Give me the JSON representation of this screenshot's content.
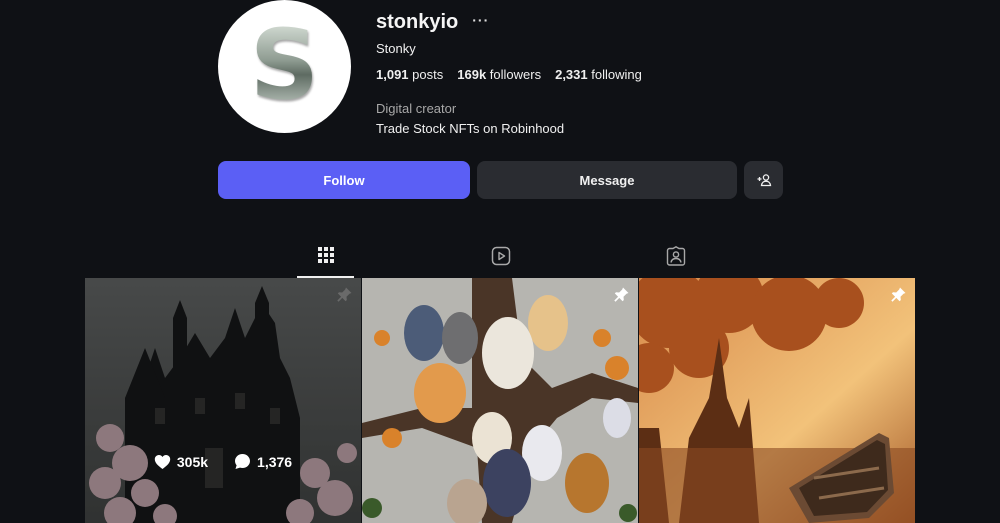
{
  "profile": {
    "avatar_letter": "S",
    "username": "stonkyio",
    "more_label": "···",
    "full_name": "Stonky",
    "stats": {
      "posts_count": "1,091",
      "posts_label": "posts",
      "followers_count": "169k",
      "followers_label": "followers",
      "following_count": "2,331",
      "following_label": "following"
    },
    "category": "Digital creator",
    "bio": "Trade Stock NFTs on Robinhood"
  },
  "actions": {
    "follow_label": "Follow",
    "message_label": "Message",
    "add_user_icon": "add-user-icon"
  },
  "tabs": [
    {
      "name": "posts",
      "icon": "grid-icon",
      "active": true
    },
    {
      "name": "reels",
      "icon": "reels-icon",
      "active": false
    },
    {
      "name": "tagged",
      "icon": "tagged-icon",
      "active": false
    }
  ],
  "posts": [
    {
      "subject": "haunted-house",
      "pinned": true,
      "hovered": true,
      "likes": "305k",
      "comments": "1,376"
    },
    {
      "subject": "cats-in-tree",
      "pinned": true,
      "hovered": false
    },
    {
      "subject": "autumn-boat",
      "pinned": true,
      "hovered": false
    }
  ],
  "colors": {
    "background": "#0f1115",
    "follow_button": "#5b5ff5",
    "secondary_button": "#2a2c31",
    "muted_text": "#a8a8a8"
  }
}
